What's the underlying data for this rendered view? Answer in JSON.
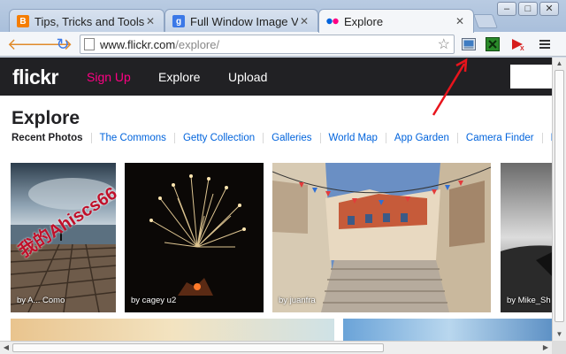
{
  "tabs": [
    {
      "title": "Tips, Tricks and Tools",
      "favicon_color": "#f57d00",
      "favicon_glyph": "B"
    },
    {
      "title": "Full Window Image Vie",
      "favicon_color": "#3b78e7",
      "favicon_glyph": "g"
    },
    {
      "title": "Explore",
      "favicon_color": "#ff0084",
      "favicon_glyph": ""
    }
  ],
  "window_controls": [
    "–",
    "□",
    "✕"
  ],
  "toolbar": {
    "url_host": "www.flickr.com",
    "url_path": "/explore/",
    "extensions": [
      "image-viewer-icon",
      "spreadsheet-icon",
      "video-icon",
      "menu-icon"
    ]
  },
  "flickr": {
    "logo": "flickr",
    "nav": {
      "signup": "Sign Up",
      "explore": "Explore",
      "upload": "Upload"
    },
    "heading": "Explore",
    "subnav": [
      "Recent Photos",
      "The Commons",
      "Getty Collection",
      "Galleries",
      "World Map",
      "App Garden",
      "Camera Finder",
      "Flick"
    ],
    "photos": [
      {
        "by": "by A... Como"
      },
      {
        "by": "by cagey u2"
      },
      {
        "by": "by juanfra"
      },
      {
        "by": "by Mike_Sh"
      }
    ]
  },
  "watermark": "我的Ahiscs66",
  "colors": {
    "accent_pink": "#ff0084",
    "link_blue": "#0063dc",
    "nav_bg": "#212124",
    "arrow_red": "#e8141c"
  }
}
